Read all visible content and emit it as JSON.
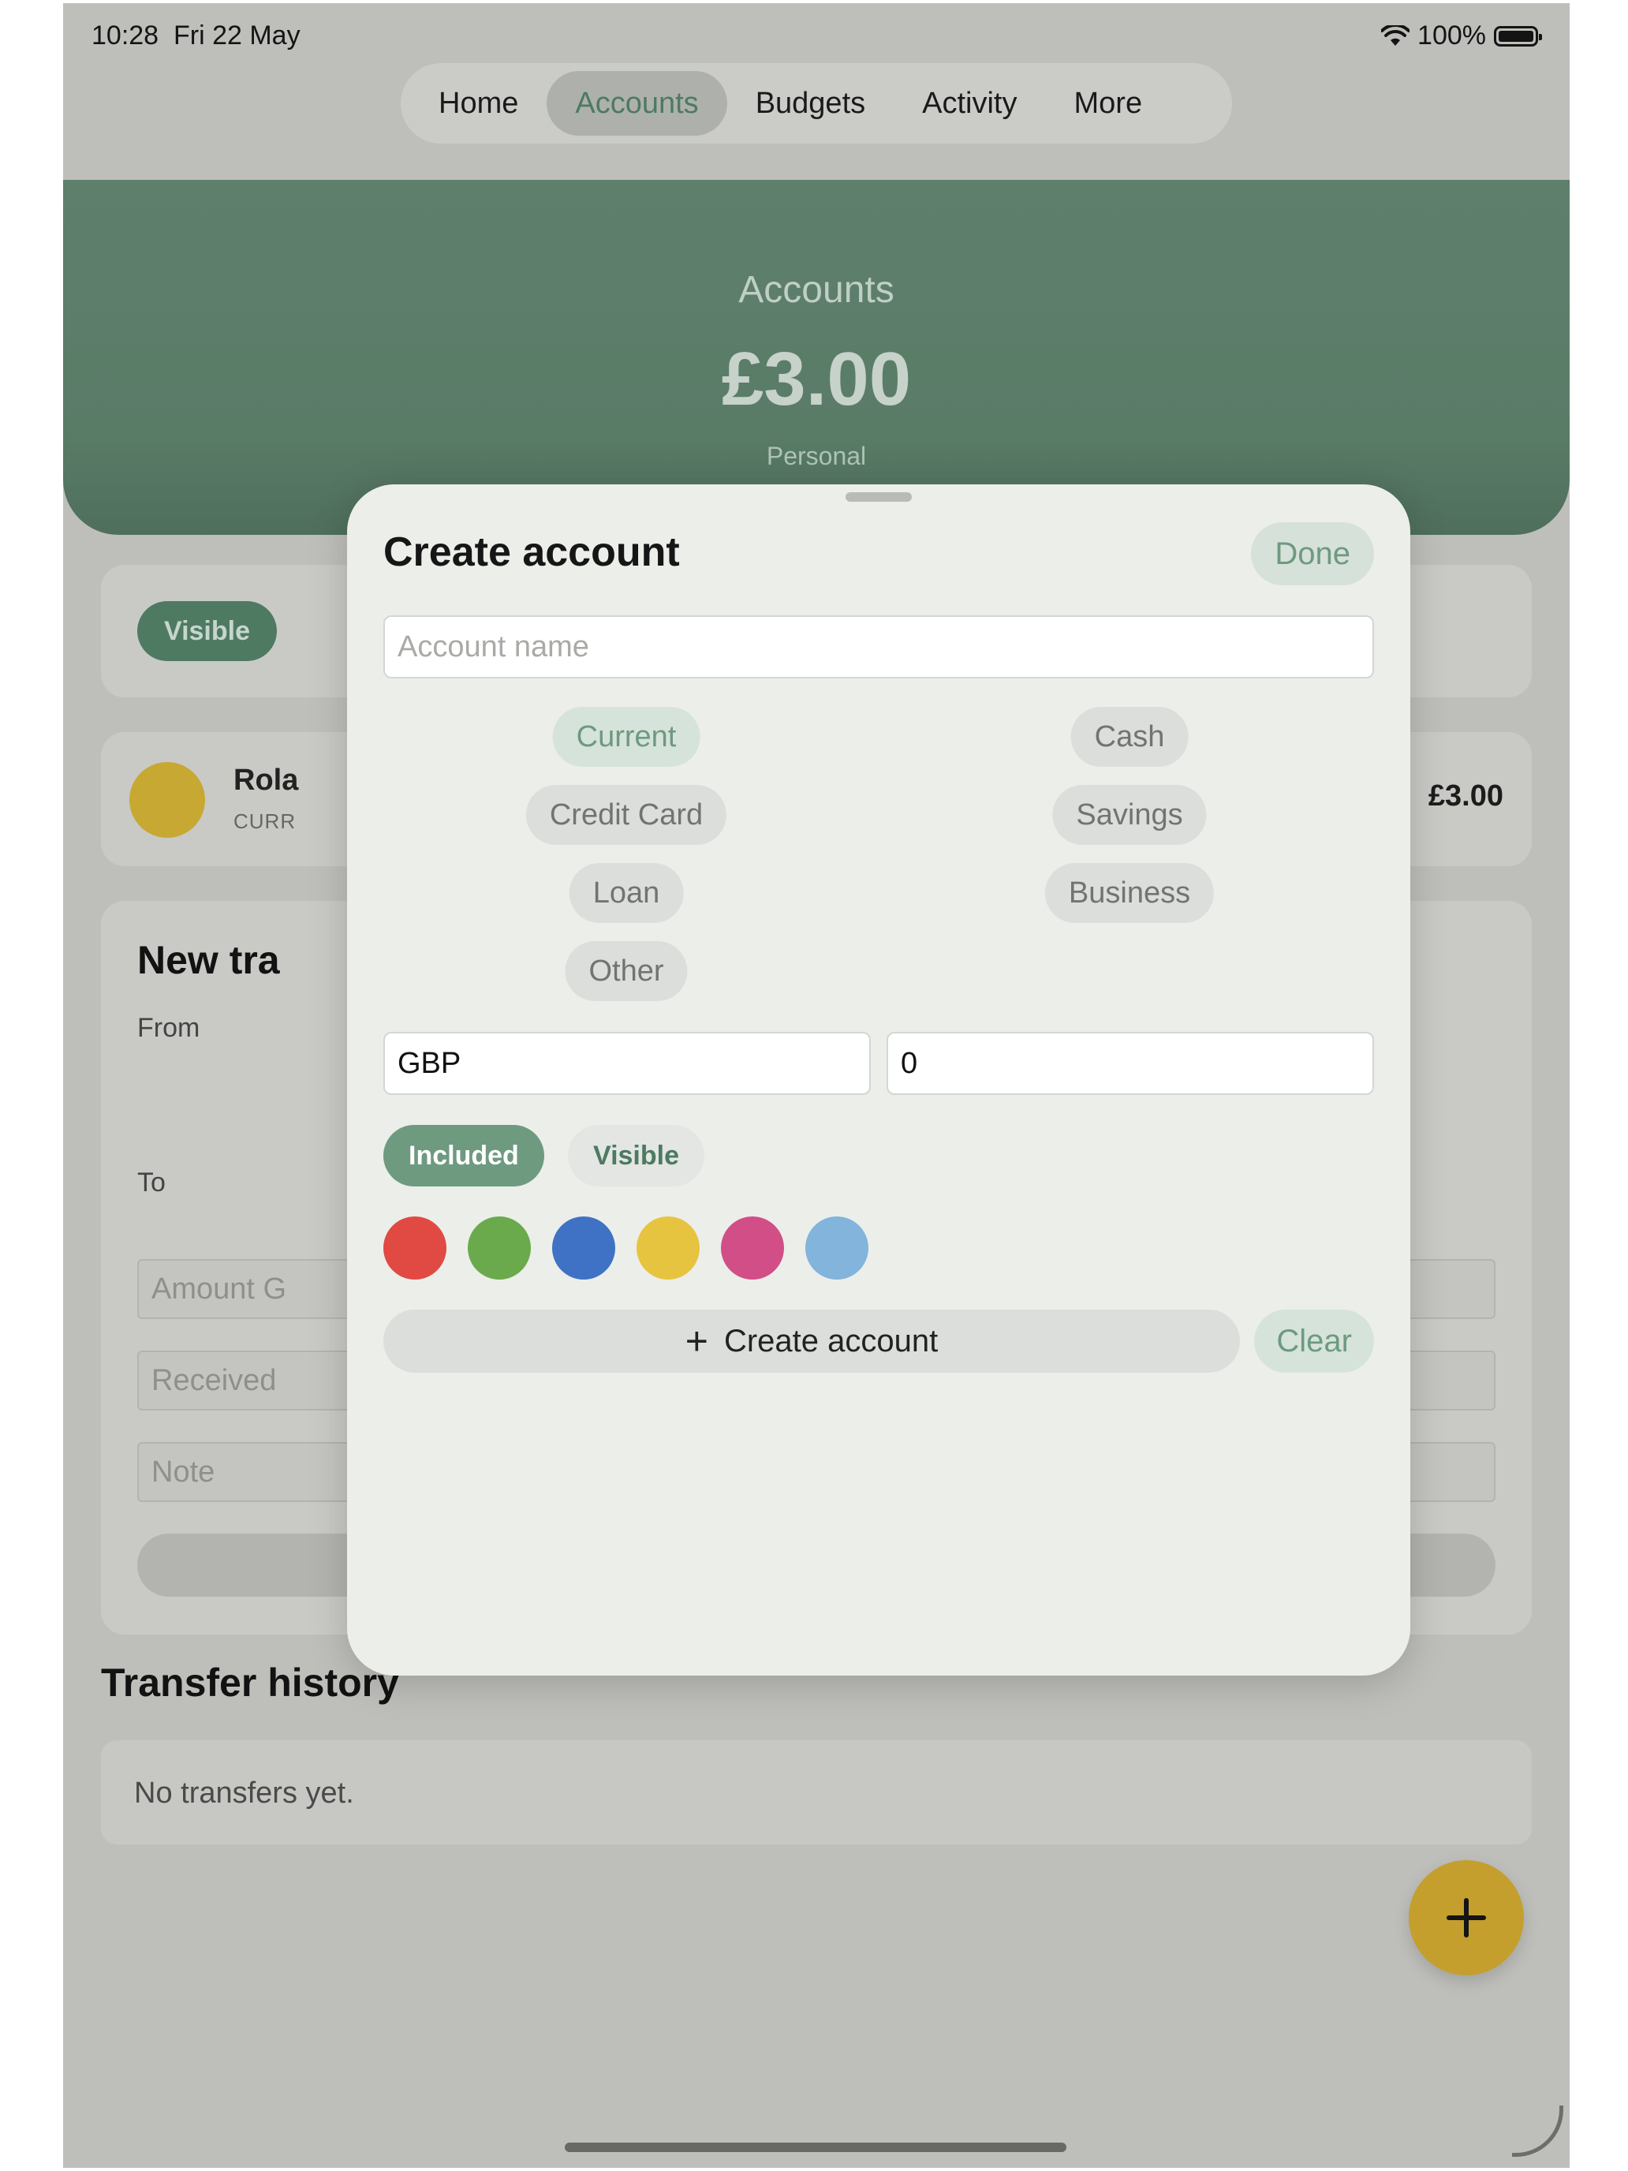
{
  "status_bar": {
    "time": "10:28",
    "date": "Fri 22 May",
    "battery": "100%"
  },
  "nav": {
    "tabs": [
      "Home",
      "Accounts",
      "Budgets",
      "Activity",
      "More"
    ],
    "active": "Accounts"
  },
  "header": {
    "title": "Accounts",
    "amount": "£3.00",
    "subtitle": "Personal"
  },
  "background": {
    "filter_visible": "Visible",
    "account": {
      "name": "Rola",
      "type": "CURR",
      "balance": "£3.00"
    },
    "transfer": {
      "title": "New tra",
      "from_label": "From",
      "to_label": "To",
      "amount_placeholder": "Amount G",
      "received_placeholder": "Received",
      "note_placeholder": "Note"
    },
    "history_title": "Transfer history",
    "history_empty": "No transfers yet."
  },
  "modal": {
    "title": "Create account",
    "done_label": "Done",
    "name_placeholder": "Account name",
    "account_types": [
      "Current",
      "Cash",
      "Credit Card",
      "Savings",
      "Loan",
      "Business",
      "Other"
    ],
    "selected_type": "Current",
    "currency": "GBP",
    "opening_balance": "0",
    "included_label": "Included",
    "visible_label": "Visible",
    "included_on": true,
    "visible_on": false,
    "colors": [
      "#e04a43",
      "#6aaa4d",
      "#3f72c4",
      "#e7c440",
      "#d24e87",
      "#82b4dc"
    ],
    "create_label": "Create account",
    "clear_label": "Clear"
  },
  "icons": {
    "fab": "plus-icon",
    "create": "plus-icon",
    "wifi": "wifi-icon",
    "battery": "battery-icon"
  }
}
